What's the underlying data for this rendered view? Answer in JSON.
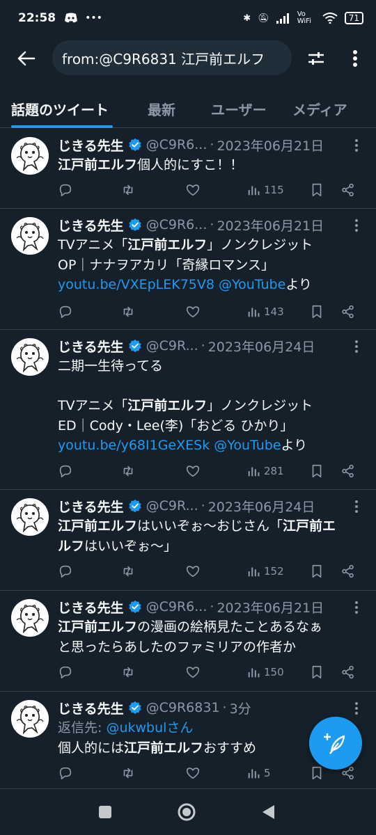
{
  "status": {
    "time": "22:58",
    "network": "Vo WiFi",
    "battery": "71"
  },
  "header": {
    "search_value": "from:@C9R6831 江戸前エルフ"
  },
  "tabs": [
    {
      "label": "話題のツイート",
      "active": true
    },
    {
      "label": "最新",
      "active": false
    },
    {
      "label": "ユーザー",
      "active": false
    },
    {
      "label": "メディア",
      "active": false
    }
  ],
  "tweets": [
    {
      "name": "じきる先生",
      "handle": "@C9R6...",
      "dot": "·",
      "date": "2023年06月21日",
      "lines": [
        [
          {
            "t": "江戸前エルフ",
            "b": true
          },
          {
            "t": "個人的にすこ！！"
          }
        ]
      ],
      "views": "115"
    },
    {
      "name": "じきる先生",
      "handle": "@C9R6...",
      "dot": "·",
      "date": "2023年06月21日",
      "lines": [
        [
          {
            "t": "TVアニメ「"
          },
          {
            "t": "江戸前エルフ",
            "b": true
          },
          {
            "t": "」ノンクレジット"
          }
        ],
        [
          {
            "t": "OP｜ナナヲアカリ「奇縁ロマンス」"
          }
        ],
        [
          {
            "t": "youtu.be/VXEpLEK75V8",
            "link": true
          },
          {
            "t": " "
          },
          {
            "t": "@YouTube",
            "link": true
          },
          {
            "t": "より"
          }
        ]
      ],
      "views": "143"
    },
    {
      "name": "じきる先生",
      "handle": "@C9R...",
      "dot": "·",
      "date": "2023年06月24日",
      "lines": [
        [
          {
            "t": "二期一生待ってる"
          }
        ],
        [
          {
            "t": " "
          }
        ],
        [
          {
            "t": "TVアニメ「"
          },
          {
            "t": "江戸前エルフ",
            "b": true
          },
          {
            "t": "」ノンクレジット"
          }
        ],
        [
          {
            "t": "ED｜Cody・Lee(李)「おどる ひかり」"
          }
        ],
        [
          {
            "t": "youtu.be/y68I1GeXESk",
            "link": true
          },
          {
            "t": " "
          },
          {
            "t": "@YouTube",
            "link": true
          },
          {
            "t": "より"
          }
        ]
      ],
      "views": "281"
    },
    {
      "name": "じきる先生",
      "handle": "@C9R...",
      "dot": "·",
      "date": "2023年06月24日",
      "lines": [
        [
          {
            "t": "江戸前エルフ",
            "b": true
          },
          {
            "t": "はいいぞぉ〜おじさん「"
          },
          {
            "t": "江戸前エ",
            "b": true
          }
        ],
        [
          {
            "t": "ルフ",
            "b": true
          },
          {
            "t": "はいいぞぉ〜」"
          }
        ]
      ],
      "views": "152"
    },
    {
      "name": "じきる先生",
      "handle": "@C9R6...",
      "dot": "·",
      "date": "2023年06月21日",
      "lines": [
        [
          {
            "t": "江戸前エルフ",
            "b": true
          },
          {
            "t": "の漫画の絵柄見たことあるなぁ"
          }
        ],
        [
          {
            "t": "と思ったらあしたのファミリアの作者か"
          }
        ]
      ],
      "views": "150"
    },
    {
      "name": "じきる先生",
      "handle": "@C9R6831",
      "dot": "·",
      "date": "3分",
      "lines": [
        [
          {
            "t": "返信先: ",
            "reply": true
          },
          {
            "t": "@ukwbulさん",
            "link": true
          }
        ],
        [
          {
            "t": "個人的には"
          },
          {
            "t": "江戸前エルフ",
            "b": true
          },
          {
            "t": "おすすめ"
          }
        ]
      ],
      "views": "5"
    }
  ]
}
